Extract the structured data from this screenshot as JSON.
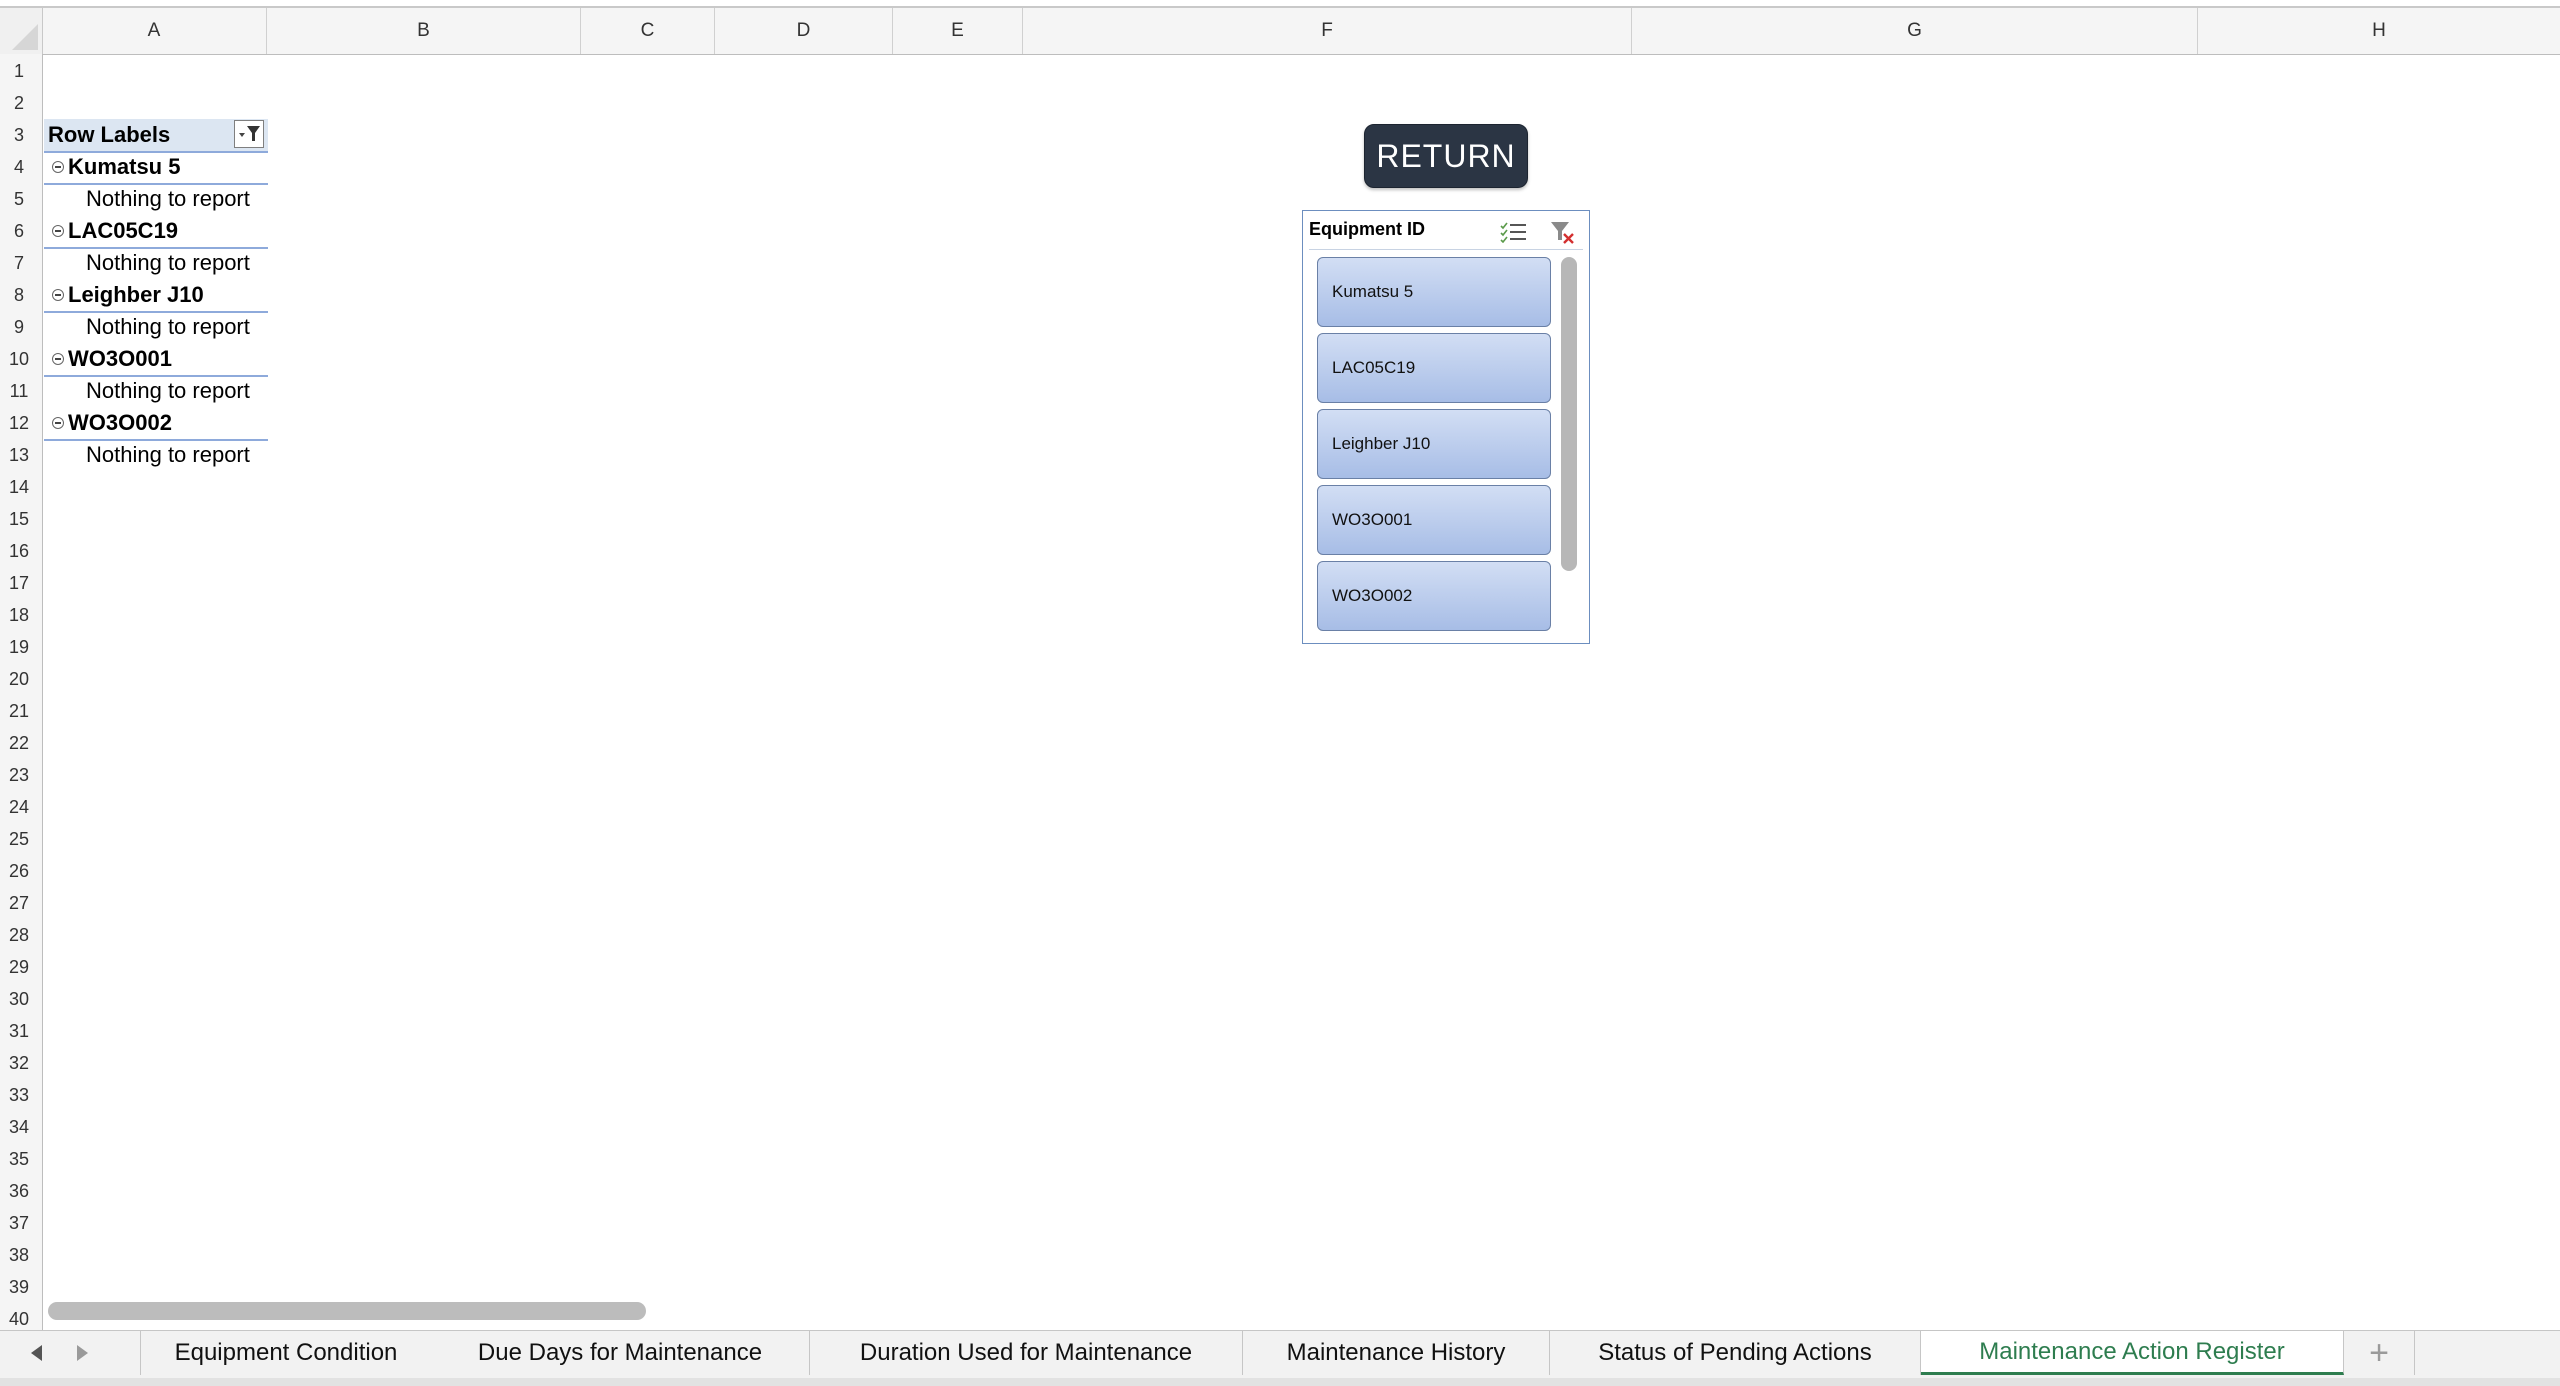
{
  "columns": [
    "A",
    "B",
    "C",
    "D",
    "E",
    "F",
    "G",
    "H"
  ],
  "rows": [
    "1",
    "2",
    "3",
    "4",
    "5",
    "6",
    "7",
    "8",
    "9",
    "10",
    "11",
    "12",
    "13",
    "14",
    "15",
    "16",
    "17",
    "18",
    "19",
    "20",
    "21",
    "22",
    "23",
    "24",
    "25",
    "26",
    "27",
    "28",
    "29",
    "30",
    "31",
    "32",
    "33",
    "34",
    "35",
    "36",
    "37",
    "38",
    "39",
    "40"
  ],
  "pivot": {
    "header": "Row Labels",
    "items": [
      {
        "label": "Kumatsu 5",
        "detail": "Nothing to report"
      },
      {
        "label": "LAC05C19",
        "detail": "Nothing to report"
      },
      {
        "label": "Leighber J10",
        "detail": "Nothing to report"
      },
      {
        "label": "WO3O001",
        "detail": "Nothing to report"
      },
      {
        "label": "WO3O002",
        "detail": "Nothing to report"
      }
    ]
  },
  "return_button": "RETURN",
  "slicer": {
    "title": "Equipment ID",
    "items": [
      "Kumatsu 5",
      "LAC05C19",
      "Leighber J10",
      "WO3O001",
      "WO3O002"
    ]
  },
  "tabs": [
    {
      "label": "Equipment Condition",
      "active": false
    },
    {
      "label": "Due Days for Maintenance",
      "active": false
    },
    {
      "label": "Duration Used for Maintenance",
      "active": false
    },
    {
      "label": "Maintenance History",
      "active": false
    },
    {
      "label": "Status of Pending Actions",
      "active": false
    },
    {
      "label": "Maintenance Action Register",
      "active": true
    }
  ],
  "add_tab": "+",
  "colors": {
    "accent_tab": "#2e7d4f",
    "slicer_button": "#a7bde6",
    "return_bg": "#2b3544"
  }
}
